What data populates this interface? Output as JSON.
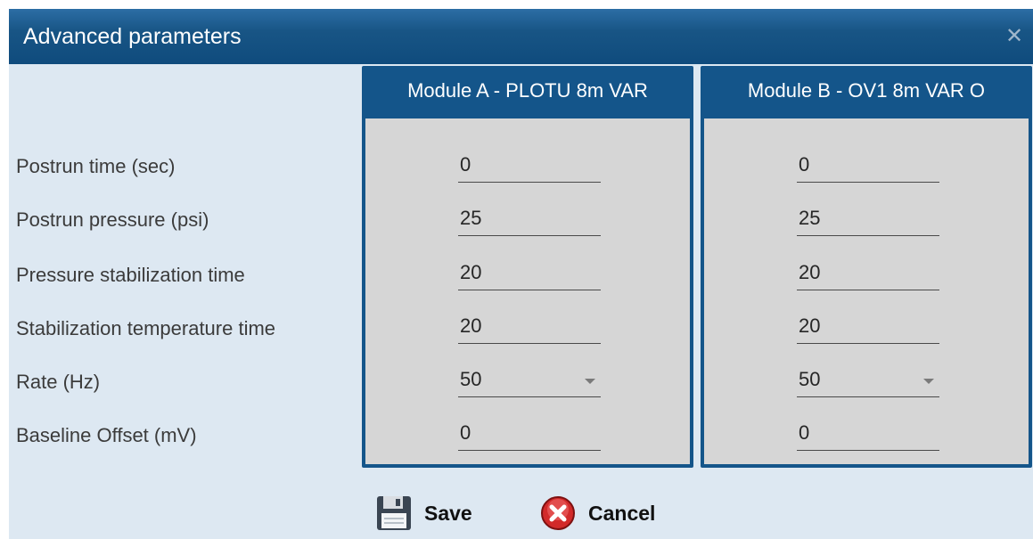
{
  "dialog": {
    "title": "Advanced parameters",
    "close_symbol": "✕"
  },
  "parameters": [
    {
      "label": "Postrun time (sec)"
    },
    {
      "label": "Postrun pressure (psi)"
    },
    {
      "label": "Pressure stabilization time"
    },
    {
      "label": "Stabilization temperature time"
    },
    {
      "label": "Rate (Hz)"
    },
    {
      "label": "Baseline Offset (mV)"
    }
  ],
  "modules": [
    {
      "header": "Module A - PLOTU 8m VAR",
      "values": {
        "postrun_time": "0",
        "postrun_pressure": "25",
        "pressure_stabilization": "20",
        "stabilization_temperature": "20",
        "rate": "50",
        "baseline_offset": "0"
      }
    },
    {
      "header": "Module B - OV1 8m VAR O",
      "values": {
        "postrun_time": "0",
        "postrun_pressure": "25",
        "pressure_stabilization": "20",
        "stabilization_temperature": "20",
        "rate": "50",
        "baseline_offset": "0"
      }
    }
  ],
  "footer": {
    "save_label": "Save",
    "cancel_label": "Cancel"
  },
  "icons": {
    "save": "floppy-disk-icon",
    "cancel": "red-x-circle-icon",
    "close": "close-icon"
  },
  "colors": {
    "titlebar": "#185585",
    "module_header": "#14558a",
    "panel_bg": "#dde8f2",
    "field_bg": "#d6d6d6"
  }
}
